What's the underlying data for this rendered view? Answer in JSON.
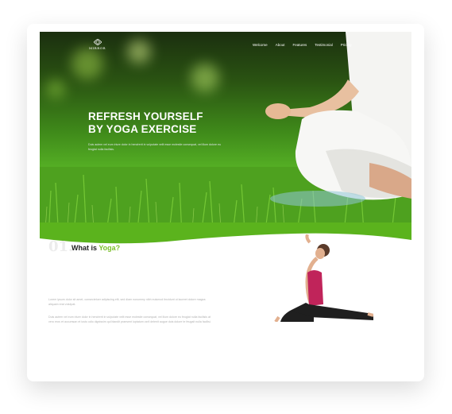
{
  "brand": {
    "name": "MIRROR"
  },
  "nav": {
    "items": [
      "Welcome",
      "About",
      "Features",
      "Testimonial",
      "Pricing"
    ]
  },
  "hero": {
    "title_line1": "REFRESH YOURSELF",
    "title_line2": "BY YOGA EXERCISE",
    "description": "Duis autem vel eum iriure dolor in hendrerit in vulputate velit esse molestie consequat, vel illum dolore eu feugiat nulla facilisis."
  },
  "section": {
    "number": "01.",
    "heading_prefix": "What is ",
    "heading_accent": "Yoga?",
    "paragraph1": "Lorem ipsum dolor sit amet, consectetuer adipiscing elit, sed diam nonummy nibh euismod tincidunt ut laoreet dolore magna aliquam erat volutpat.",
    "paragraph2": "Duis autem vel eum iriure dolor in hendrerit in vulputate velit esse molestie consequat, vel illum dolore eu feugiat nulla facilisis at vero eros et accumsan et iusto odio dignissim qui blandit praesent luptatum zzril delenit augue duis dolore te feugait nulla facilisi."
  },
  "colors": {
    "accent": "#7bbf2b",
    "grass": "#56b125"
  },
  "icons": {
    "logo": "diamond-logo-icon"
  }
}
